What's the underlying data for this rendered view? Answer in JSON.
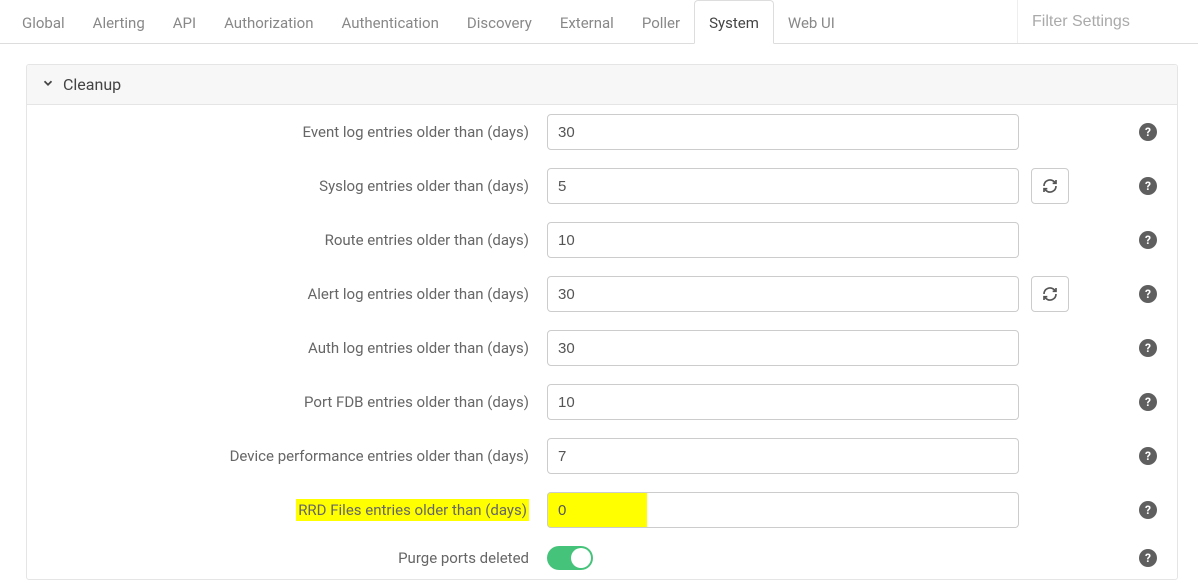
{
  "filter_placeholder": "Filter Settings",
  "tabs": [
    {
      "label": "Global",
      "active": false
    },
    {
      "label": "Alerting",
      "active": false
    },
    {
      "label": "API",
      "active": false
    },
    {
      "label": "Authorization",
      "active": false
    },
    {
      "label": "Authentication",
      "active": false
    },
    {
      "label": "Discovery",
      "active": false
    },
    {
      "label": "External",
      "active": false
    },
    {
      "label": "Poller",
      "active": false
    },
    {
      "label": "System",
      "active": true
    },
    {
      "label": "Web UI",
      "active": false
    }
  ],
  "panel": {
    "title": "Cleanup"
  },
  "rows": [
    {
      "label": "Event log entries older than (days)",
      "value": "30",
      "reset": false,
      "highlight": false
    },
    {
      "label": "Syslog entries older than (days)",
      "value": "5",
      "reset": true,
      "highlight": false
    },
    {
      "label": "Route entries older than (days)",
      "value": "10",
      "reset": false,
      "highlight": false
    },
    {
      "label": "Alert log entries older than (days)",
      "value": "30",
      "reset": true,
      "highlight": false
    },
    {
      "label": "Auth log entries older than (days)",
      "value": "30",
      "reset": false,
      "highlight": false
    },
    {
      "label": "Port FDB entries older than (days)",
      "value": "10",
      "reset": false,
      "highlight": false
    },
    {
      "label": "Device performance entries older than (days)",
      "value": "7",
      "reset": false,
      "highlight": false
    },
    {
      "label": "RRD Files entries older than (days)",
      "value": "0",
      "reset": false,
      "highlight": true
    }
  ],
  "toggle_row": {
    "label": "Purge ports deleted",
    "on": true
  }
}
